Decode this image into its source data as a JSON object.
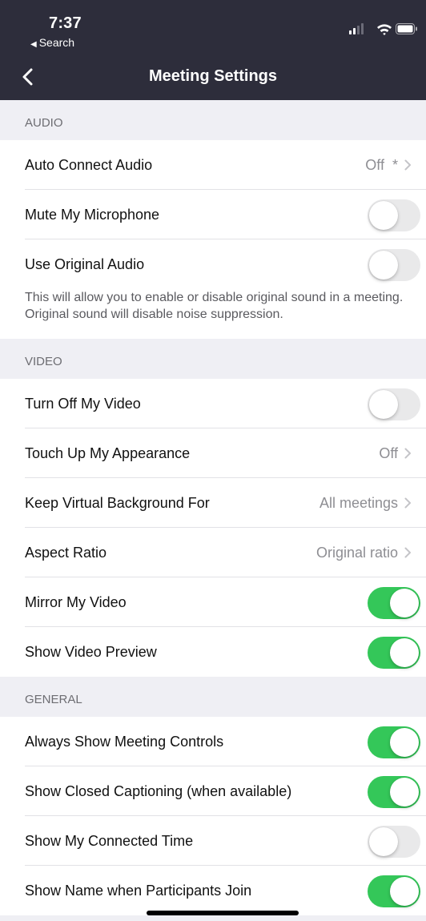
{
  "status_bar": {
    "time": "7:37",
    "back_app": "Search"
  },
  "nav": {
    "title": "Meeting Settings"
  },
  "audio": {
    "header": "AUDIO",
    "auto_connect_label": "Auto Connect Audio",
    "auto_connect_value": "Off",
    "auto_connect_marker": "*",
    "mute_label": "Mute My Microphone",
    "mute_on": false,
    "original_audio_label": "Use Original Audio",
    "original_audio_on": false,
    "original_audio_desc": "This will allow you to enable or disable original sound in a meeting. Original sound will disable noise suppression."
  },
  "video": {
    "header": "VIDEO",
    "turn_off_label": "Turn Off My Video",
    "turn_off_on": false,
    "touch_up_label": "Touch Up My Appearance",
    "touch_up_value": "Off",
    "virtual_bg_label": "Keep Virtual Background For",
    "virtual_bg_value": "All meetings",
    "aspect_label": "Aspect Ratio",
    "aspect_value": "Original ratio",
    "mirror_label": "Mirror My Video",
    "mirror_on": true,
    "preview_label": "Show Video Preview",
    "preview_on": true
  },
  "general": {
    "header": "GENERAL",
    "controls_label": "Always Show Meeting Controls",
    "controls_on": true,
    "captioning_label": "Show Closed Captioning (when available)",
    "captioning_on": true,
    "connected_time_label": "Show My Connected Time",
    "connected_time_on": false,
    "name_join_label": "Show Name when Participants Join",
    "name_join_on": true
  },
  "colors": {
    "header_bg": "#2d2d3b",
    "toggle_on": "#34c759",
    "toggle_off": "#e9e9ea",
    "page_bg": "#efeff4"
  }
}
